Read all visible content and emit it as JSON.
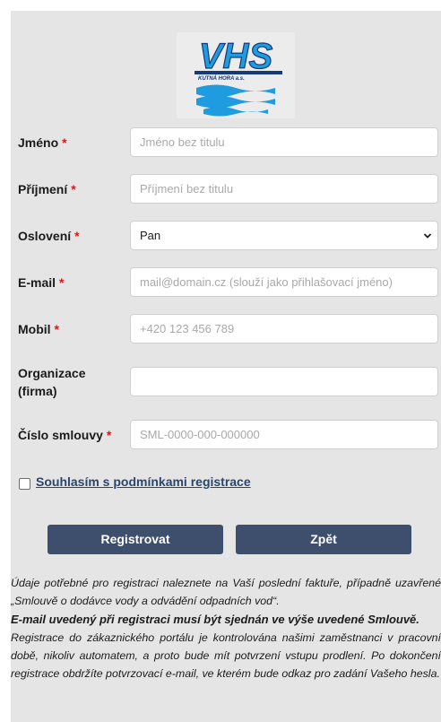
{
  "logo": {
    "text": "VHS",
    "subtext": "KUTNÁ HORA a.s."
  },
  "form": {
    "fields": [
      {
        "label": "Jméno",
        "required": "*",
        "placeholder": "Jméno bez titulu"
      },
      {
        "label": "Příjmení",
        "required": "*",
        "placeholder": "Příjmení bez titulu"
      },
      {
        "label": "Oslovení",
        "required": "*",
        "value": "Pan"
      },
      {
        "label": "E-mail",
        "required": "*",
        "placeholder": "mail@domain.cz (slouží jako přihlašovací jméno)"
      },
      {
        "label": "Mobil",
        "required": "*",
        "placeholder": "+420 123 456 789"
      },
      {
        "label": "Organizace (firma)",
        "required": "",
        "placeholder": ""
      },
      {
        "label": "Číslo smlouvy",
        "required": "*",
        "placeholder": "SML-0000-000-000000"
      }
    ],
    "consent_label": "Souhlasím s podmínkami registrace",
    "submit_label": "Registrovat",
    "back_label": "Zpět"
  },
  "info": {
    "p1": "Údaje potřebné pro registraci naleznete na Vaší poslední faktuře, případně uzavřené „Smlouvě o dodávce vody a odvádění odpadních vod“.",
    "p2": "E-mail uvedený při registraci musí být sjednán ve výše uvedené Smlouvě.",
    "p3": "Registrace do zákaznického portálu je kontrolována našimi zaměstnanci v pracovní době, nikoliv automatem, a proto bude mít potvrzení vstupu prodlení. Po dokončení registrace obdržíte potvrzovací e-mail, ve kterém bude odkaz pro zadání Vašeho hesla."
  },
  "colors": {
    "accent": "#3e4f6e",
    "required": "#d01c1c",
    "link": "#2a466e",
    "logo_blue": "#1a8fd6"
  }
}
